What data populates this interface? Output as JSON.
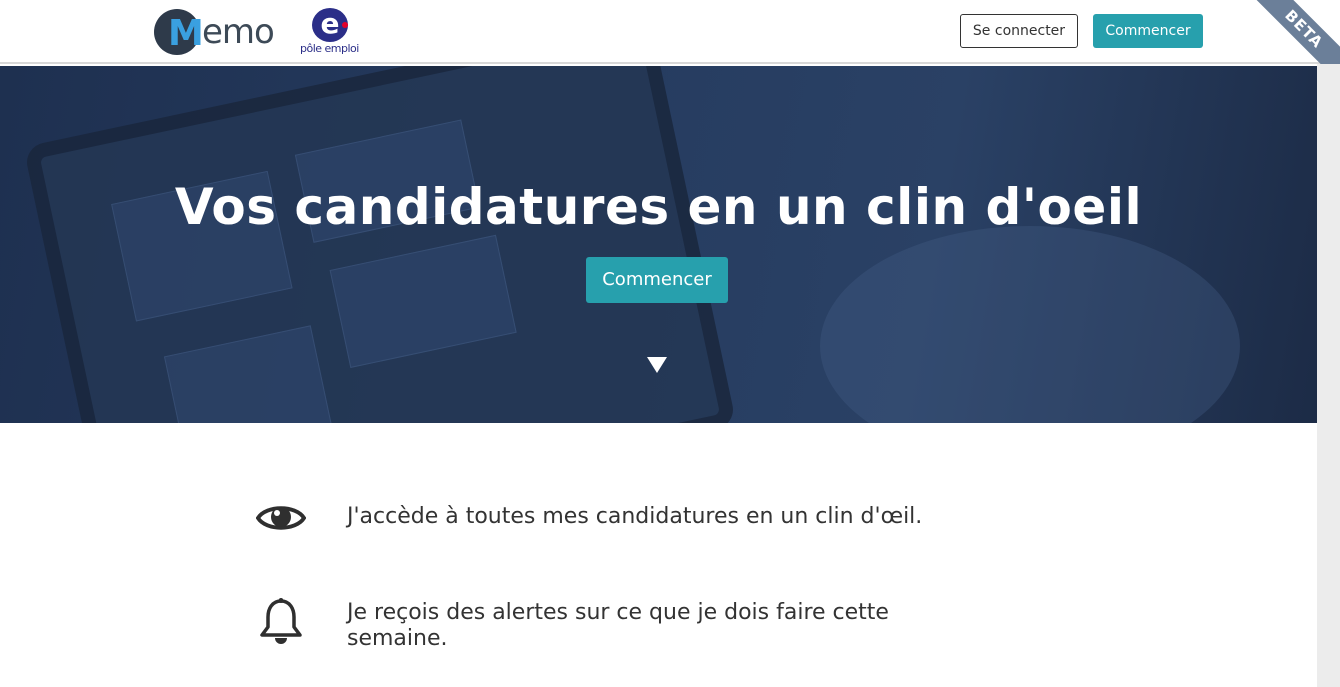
{
  "header": {
    "memo_logo": "emo",
    "pole_emploi_logo": "pôle emploi",
    "login_label": "Se connecter",
    "start_label": "Commencer",
    "beta_label": "BETA"
  },
  "hero": {
    "title": "Vos candidatures en un clin d'oeil",
    "button_label": "Commencer",
    "scroll_icon": "triangle-down-icon"
  },
  "features": [
    {
      "icon": "eye-icon",
      "text": "J'accède à toutes mes candidatures en un clin d'œil."
    },
    {
      "icon": "bell-icon",
      "text": "Je reçois des alertes sur ce que je dois faire cette semaine."
    }
  ],
  "colors": {
    "accent": "#27a0ad",
    "hero_bg": "#263c60",
    "beta_ribbon": "#6b7f99"
  }
}
